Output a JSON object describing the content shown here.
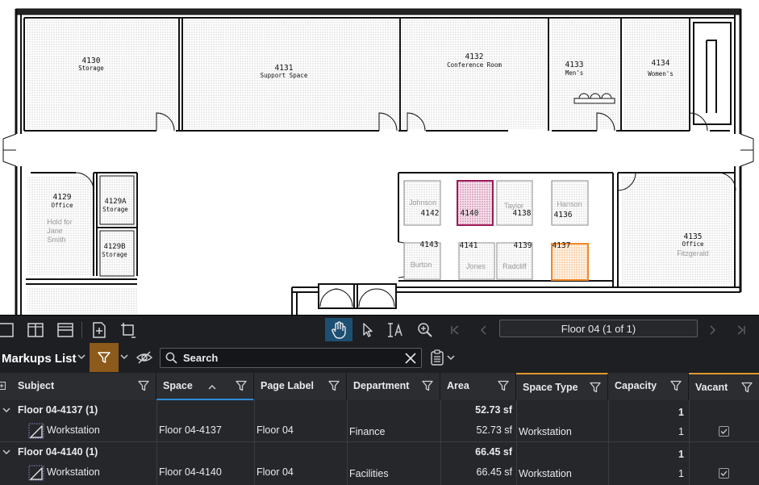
{
  "plan": {
    "rooms": {
      "r4130": {
        "num": "4130",
        "name": "Storage"
      },
      "r4131": {
        "num": "4131",
        "name": "Support Space"
      },
      "r4132": {
        "num": "4132",
        "name": "Conference Room"
      },
      "r4133": {
        "num": "4133",
        "name": "Men's"
      },
      "r4134": {
        "num": "4134",
        "name": "Women's"
      },
      "r4129": {
        "num": "4129",
        "name": "Office",
        "occupant": "Hold for\nJane\nSmith"
      },
      "r4129a": {
        "num": "4129A",
        "name": "Storage"
      },
      "r4129b": {
        "num": "4129B",
        "name": "Storage"
      },
      "r4135": {
        "num": "4135",
        "name": "Office",
        "occupant": "Fitzgerald"
      }
    },
    "workstations": [
      {
        "num": "4142",
        "occupant": "Johnson"
      },
      {
        "num": "4140",
        "occupant": ""
      },
      {
        "num": "4138",
        "occupant": "Taylor"
      },
      {
        "num": "4136",
        "occupant": "Hanson"
      },
      {
        "num": "4143",
        "occupant": "Burton"
      },
      {
        "num": "4141",
        "occupant": "Jones"
      },
      {
        "num": "4139",
        "occupant": "Radcliff"
      },
      {
        "num": "4137",
        "occupant": ""
      }
    ],
    "colors": {
      "highlight_4140": "#9b1b5a",
      "highlight_4137": "#f0892a"
    }
  },
  "toolbar": {
    "page_label": "Floor 04 (1 of 1)",
    "icons": [
      "single-page-icon",
      "split-vertical-icon",
      "split-horizontal-icon",
      "add-page-icon",
      "page-setup-icon",
      "pan-hand-icon",
      "select-arrow-icon",
      "text-select-icon",
      "zoom-icon",
      "first-page-icon",
      "previous-page-icon",
      "next-page-icon",
      "last-page-icon"
    ],
    "active_tool": "pan"
  },
  "markups": {
    "title": "Markups List",
    "search_placeholder": "Search",
    "accent": "#8c5a1a"
  },
  "grid": {
    "columns": [
      {
        "label": "Subject"
      },
      {
        "label": "Space",
        "sorted": "ascending"
      },
      {
        "label": "Page Label"
      },
      {
        "label": "Department"
      },
      {
        "label": "Area"
      },
      {
        "label": "Space Type"
      },
      {
        "label": "Capacity"
      },
      {
        "label": "Vacant"
      }
    ],
    "groups": [
      {
        "title": "Floor 04-4137 (1)",
        "area": "52.73 sf",
        "capacity": "1",
        "item": {
          "subject": "Workstation",
          "space": "Floor 04-4137",
          "page": "Floor 04",
          "department": "Finance",
          "area": "52.73 sf",
          "type": "Workstation",
          "capacity": "1",
          "vacant": true
        }
      },
      {
        "title": "Floor 04-4140 (1)",
        "area": "66.45 sf",
        "capacity": "1",
        "item": {
          "subject": "Workstation",
          "space": "Floor 04-4140",
          "page": "Floor 04",
          "department": "Facilities",
          "area": "66.45 sf",
          "type": "Workstation",
          "capacity": "1",
          "vacant": true
        }
      }
    ]
  }
}
